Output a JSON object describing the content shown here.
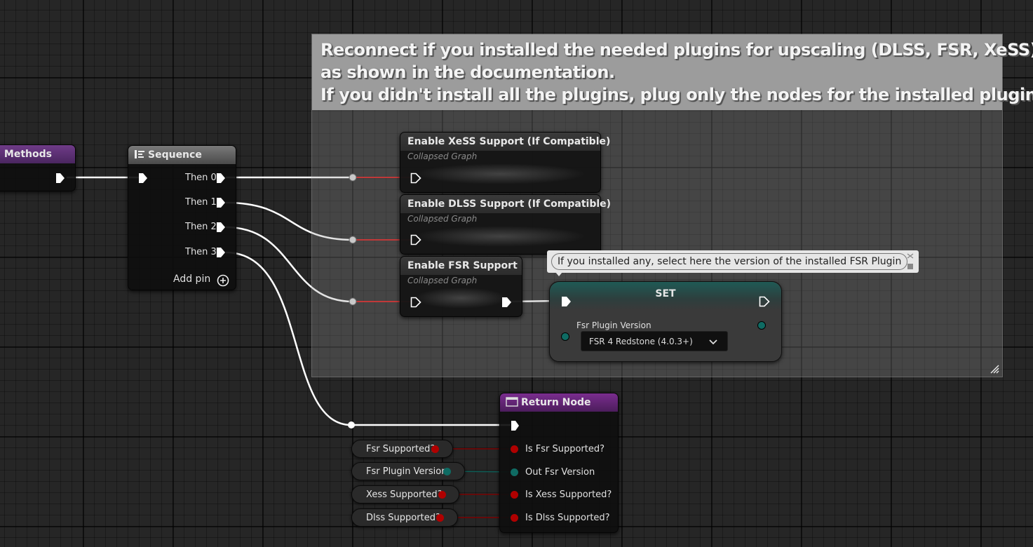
{
  "comment": {
    "lines": [
      "Reconnect if you installed the needed plugins for upscaling (DLSS, FSR, XeSS)",
      "as shown in the documentation.",
      "If you didn't install all the plugins, plug only the nodes for the installed plugins."
    ]
  },
  "function_entry": {
    "title": "g Methods"
  },
  "sequence": {
    "title": "Sequence",
    "outputs": [
      "Then 0",
      "Then 1",
      "Then 2",
      "Then 3"
    ],
    "add_pin_label": "Add pin"
  },
  "collapsed_nodes": [
    {
      "title": "Enable XeSS Support (If Compatible)",
      "subtitle": "Collapsed Graph"
    },
    {
      "title": "Enable DLSS Support (If Compatible)",
      "subtitle": "Collapsed Graph"
    },
    {
      "title": "Enable FSR Support",
      "subtitle": "Collapsed Graph"
    }
  ],
  "tooltip": {
    "text": "If you installed any, select here the version of the installed FSR Plugin"
  },
  "set_node": {
    "title": "SET",
    "variable_label": "Fsr Plugin Version",
    "dropdown_value": "FSR 4 Redstone (4.0.3+)"
  },
  "return_node": {
    "title": "Return Node",
    "inputs": [
      "Is Fsr Supported?",
      "Out Fsr Version",
      "Is Xess Supported?",
      "Is Dlss Supported?"
    ]
  },
  "variables": [
    "Fsr Supported?",
    "Fsr Plugin Version",
    "Xess Supported?",
    "Dlss Supported?"
  ],
  "colors": {
    "bool_pin": "#b00000",
    "enum_pin": "#0f6b63",
    "function_title": "#6a2a8a",
    "exec": "#ffffff"
  },
  "icons": [
    "sequence-icon",
    "add-pin-icon",
    "function-icon",
    "exec-pin-icon",
    "chevron-down-icon",
    "resize-grip-icon"
  ]
}
